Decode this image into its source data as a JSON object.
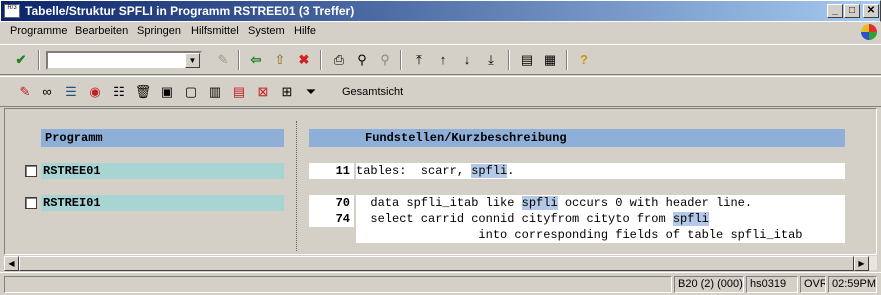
{
  "window": {
    "title": "Tabelle/Struktur SPFLI in Programm RSTREE01 (3 Treffer)",
    "app_icon_text": "R/3",
    "buttons": [
      "_",
      "□",
      "✕"
    ]
  },
  "menu": {
    "items": [
      "Programme",
      "Bearbeiten",
      "Springen",
      "Hilfsmittel",
      "System",
      "Hilfe"
    ]
  },
  "toolbar": {
    "command_field_value": "",
    "icons": [
      "enter-icon",
      "save-icon",
      "back-icon",
      "exit-icon",
      "cancel-icon",
      "print-icon",
      "find-icon",
      "find-next-icon",
      "first-page-icon",
      "previous-page-icon",
      "next-page-icon",
      "last-page-icon",
      "create-session-icon",
      "shortcut-icon",
      "help-icon"
    ]
  },
  "app_toolbar": {
    "icons": [
      "edit-icon",
      "glasses-icon",
      "list-icon",
      "target-icon",
      "stack-icon",
      "delete-icon",
      "select-icon",
      "deselect-icon",
      "table-icon",
      "expand-icon",
      "collapse-icon",
      "tree-icon",
      "filter-icon"
    ],
    "gesamtsicht_label": "Gesamtsicht"
  },
  "columns": {
    "program_header": "Programm",
    "findings_header": "Fundstellen/Kurzbeschreibung"
  },
  "results": [
    {
      "program": "RSTREE01",
      "lines": [
        {
          "no": "11",
          "pre": "tables:  scarr, ",
          "hit": "spfli",
          "post": "."
        }
      ]
    },
    {
      "program": "RSTREI01",
      "lines": [
        {
          "no": "70",
          "pre": "  data spfli_itab like ",
          "hit": "spfli",
          "post": " occurs 0 with header line."
        },
        {
          "no": "74",
          "pre": "  select carrid connid cityfrom cityto from ",
          "hit": "spfli",
          "post": ""
        },
        {
          "no": "",
          "pre": "                 into corresponding fields of table spfli_itab",
          "hit": "",
          "post": ""
        }
      ]
    }
  ],
  "status": {
    "system": "B20 (2) (000)",
    "server": "hs0319",
    "mode": "OVR",
    "time": "02:59PM"
  },
  "colors": {
    "title_gradient_start": "#0a246a",
    "header_blue": "#8eb0d8",
    "program_teal": "#a8d4d4",
    "highlight": "#b4c8e8"
  }
}
